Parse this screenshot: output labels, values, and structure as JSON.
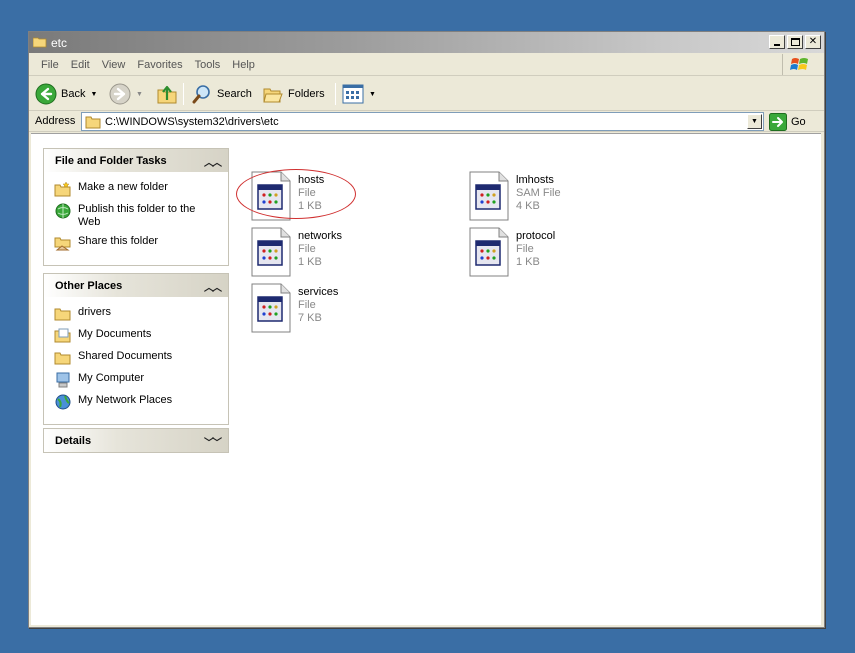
{
  "window": {
    "title": "etc"
  },
  "menu": [
    "File",
    "Edit",
    "View",
    "Favorites",
    "Tools",
    "Help"
  ],
  "toolbar": {
    "back_label": "Back",
    "search_label": "Search",
    "folders_label": "Folders"
  },
  "address": {
    "label": "Address",
    "path": "C:\\WINDOWS\\system32\\drivers\\etc",
    "go_label": "Go"
  },
  "tasks_panel": {
    "title": "File and Folder Tasks",
    "items": [
      {
        "label": "Make a new folder",
        "icon": "new-folder-icon"
      },
      {
        "label": "Publish this folder to the Web",
        "icon": "publish-web-icon"
      },
      {
        "label": "Share this folder",
        "icon": "share-folder-icon"
      }
    ]
  },
  "places_panel": {
    "title": "Other Places",
    "items": [
      {
        "label": "drivers",
        "icon": "folder-icon"
      },
      {
        "label": "My Documents",
        "icon": "my-documents-icon"
      },
      {
        "label": "Shared Documents",
        "icon": "shared-documents-icon"
      },
      {
        "label": "My Computer",
        "icon": "my-computer-icon"
      },
      {
        "label": "My Network Places",
        "icon": "network-places-icon"
      }
    ]
  },
  "details_panel": {
    "title": "Details"
  },
  "files": [
    {
      "name": "hosts",
      "type": "File",
      "size": "1 KB"
    },
    {
      "name": "lmhosts",
      "type": "SAM File",
      "size": "4 KB"
    },
    {
      "name": "networks",
      "type": "File",
      "size": "1 KB"
    },
    {
      "name": "protocol",
      "type": "File",
      "size": "1 KB"
    },
    {
      "name": "services",
      "type": "File",
      "size": "7 KB"
    }
  ],
  "colors": {
    "desktop": "#3A6EA5",
    "highlight_ellipse": "#D03030"
  }
}
